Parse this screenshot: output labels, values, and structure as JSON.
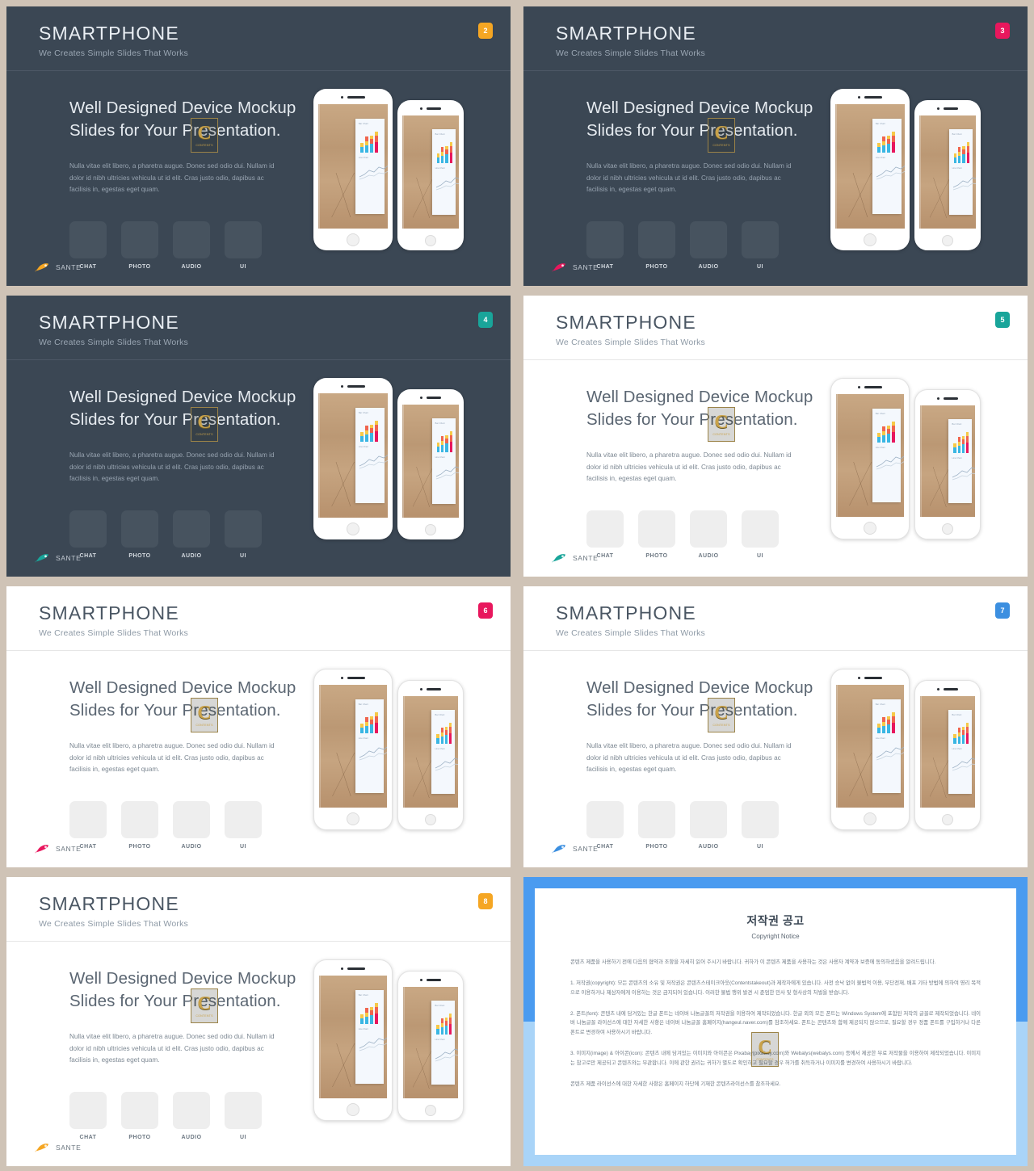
{
  "page": {
    "gutter_color": "#cfc3b6",
    "dark_bg": "#3b4754",
    "light_bg": "#ffffff"
  },
  "slide_common": {
    "title": "SMARTPHONE",
    "subtitle": "We Creates Simple Slides That Works",
    "headline_line1": "Well Designed Device Mockup",
    "headline_line2": "Slides for Your Presentation.",
    "paragraph": "Nulla vitae elit libero, a pharetra augue. Donec sed odio dui. Nullam id dolor id nibh ultricies vehicula ut id elit. Cras justo odio, dapibus ac facilisis in, egestas eget quam.",
    "tiles": [
      {
        "label": "CHAT",
        "icon": "chat-icon"
      },
      {
        "label": "PHOTO",
        "icon": "photo-icon"
      },
      {
        "label": "AUDIO",
        "icon": "audio-icon"
      },
      {
        "label": "UI",
        "icon": "ui-icon"
      }
    ],
    "logo_text": "SANTE",
    "watermark": {
      "letter": "C",
      "caption": "CONTENTS",
      "color": "#c9a24a"
    }
  },
  "slides": [
    {
      "number": "2",
      "theme": "dark",
      "badge_color": "#f5a623",
      "logo_color": "#f5a623"
    },
    {
      "number": "3",
      "theme": "dark",
      "badge_color": "#e8175d",
      "logo_color": "#e8175d"
    },
    {
      "number": "4",
      "theme": "dark",
      "badge_color": "#19a59a",
      "logo_color": "#19a59a"
    },
    {
      "number": "5",
      "theme": "light",
      "badge_color": "#19a59a",
      "logo_color": "#19a59a"
    },
    {
      "number": "6",
      "theme": "light",
      "badge_color": "#e8175d",
      "logo_color": "#e8175d"
    },
    {
      "number": "7",
      "theme": "light",
      "badge_color": "#3c8fe0",
      "logo_color": "#3c8fe0"
    },
    {
      "number": "8",
      "theme": "light",
      "badge_color": "#f5a623",
      "logo_color": "#f5a623"
    }
  ],
  "phone_card": {
    "chart_label_top": "Bar Chart",
    "chart_label_bottom": "Line Chart",
    "bar_colors": [
      "#f7c948",
      "#f0654f",
      "#3ab6e3",
      "#e8175d"
    ]
  },
  "copyright": {
    "title": "저작권 공고",
    "subtitle": "Copyright Notice",
    "intro": "콘텐츠 제품을 사용하기 전에 다음의 협약과 조항을 자세히 읽어 주시기 바랍니다. 귀하가 이 콘텐츠 제품을 사용하는 것은 사용자 계약과 보증에 동의하셨음을 알려드립니다.",
    "item1": "1. 저작권(copyright): 모든 콘텐츠의 소유 및 저작권은 콘텐츠스테이크아웃(Contentstakeout)과 제작자에게 있습니다. 사전 승낙 없이 불법적 이용, 무단전재, 배포 기타 방법에 의하여 영리 목적으로 이용하거나 제삼자에게 이용하는 것은 금지되어 있습니다. 이러한 불법 행위 발견 시 준엄한 민사 및 형사상의 처벌을 받습니다.",
    "item2": "2. 폰트(font): 콘텐츠 내에 담겨있는 한글 폰트는 네이버 나눔글꼴의 저작권을 이용하여 제작되었습니다. 한글 외의 모든 폰트는 Windows System에 포함된 저작의 글꼴로 제작되었습니다. 네이버 나눔글꼴 라이선스에 대한 자세한 사항은 네이버 나눔글꼴 홈페이지(hangeul.naver.com)를 참조하세요. 폰트는 콘텐츠와 함께 제공되지 않으므로, 필요할 경우 정품 폰트를 구입하거나 다른 폰트로 변경하여 사용하시기 바랍니다.",
    "item3": "3. 이미지(image) & 아이콘(icon): 콘텐츠 내에 담겨있는 이미지와 아이콘은 Pixabay(pixabay.com)와 Webalys(webalys.com) 등에서 제공한 무료 저작물을 이용하여 제작되었습니다. 이미지는 참고로만 제공되고 콘텐츠와는 무관합니다. 이에 관한 권리는 귀하가 별도로 확인하고 필요할 경우 허가를 취득하거나 이미지를 변경하여 사용하시기 바랍니다.",
    "outro": "콘텐츠 제품 라이선스에 대한 자세한 사항은 홈페이지 하단에 기재한 콘텐츠라이선스를 참조하세요."
  }
}
